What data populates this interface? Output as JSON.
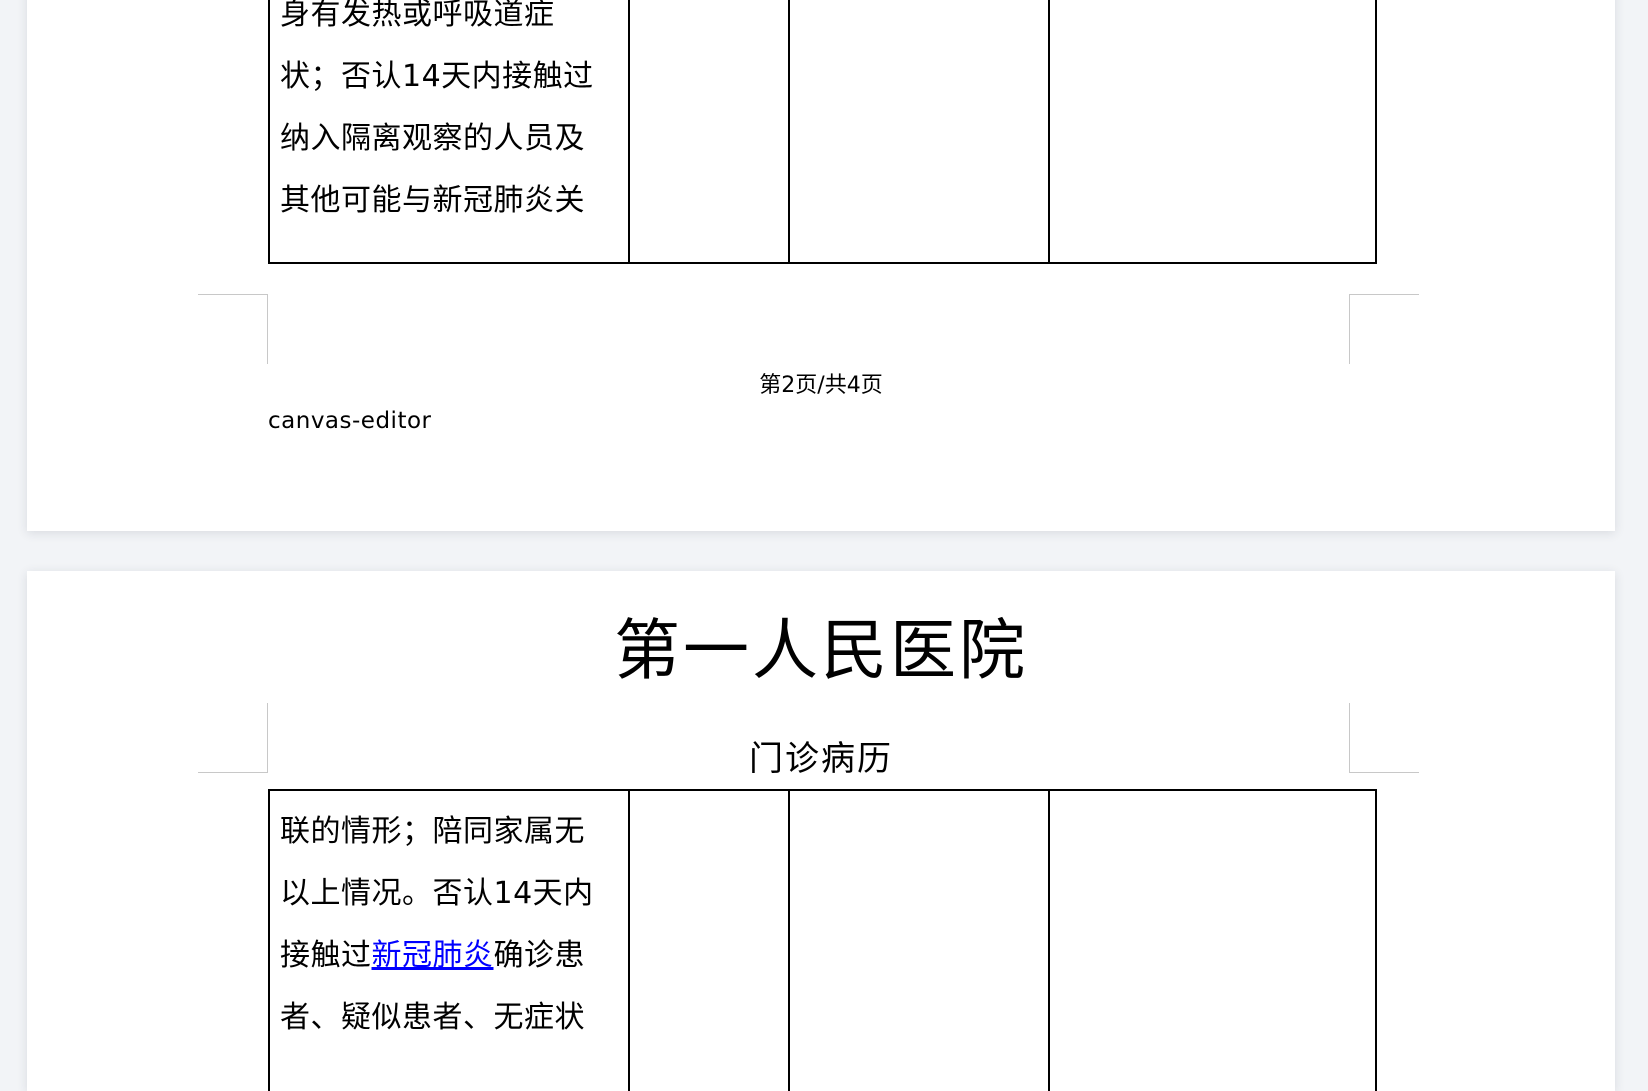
{
  "page1": {
    "table_first_cell_lines": [
      "身有发热或呼吸道症",
      "状；否认14天内接触过",
      "纳入隔离观察的人员及",
      "其他可能与新冠肺炎关"
    ],
    "page_number": "第2页/共4页",
    "footer": "canvas-editor"
  },
  "page2": {
    "header_title": "第一人民医院",
    "header_subtitle": "门诊病历",
    "table_first_cell": {
      "line1": "联的情形；陪同家属无",
      "line2": "以上情况。否认14天内",
      "line3_before": "接触过",
      "line3_link": "新冠肺炎",
      "line3_after": "确诊患",
      "line4": "者、疑似患者、无症状"
    }
  }
}
